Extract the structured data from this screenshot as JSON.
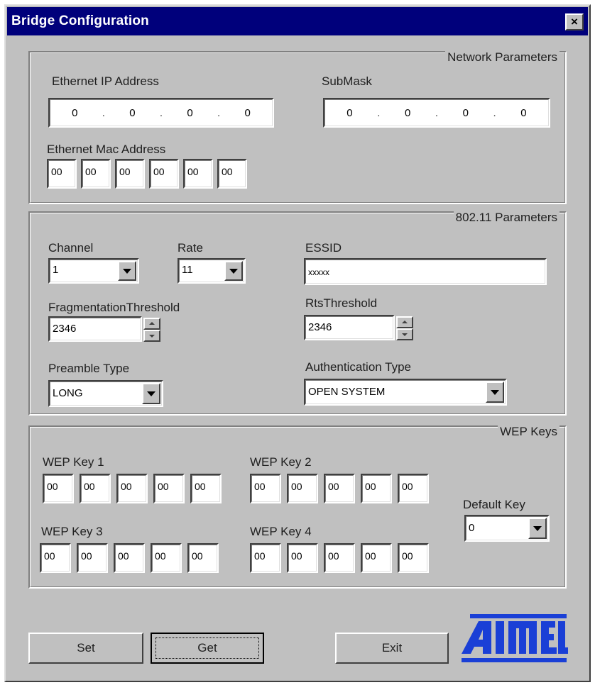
{
  "window": {
    "title": "Bridge Configuration",
    "close_label": "×"
  },
  "network": {
    "group_title": "Network Parameters",
    "ip_label": "Ethernet IP Address",
    "ip_octets": [
      "0",
      "0",
      "0",
      "0"
    ],
    "submask_label": "SubMask",
    "submask_octets": [
      "0",
      "0",
      "0",
      "0"
    ],
    "mac_label": "Ethernet Mac Address",
    "mac_bytes": [
      "00",
      "00",
      "00",
      "00",
      "00",
      "00"
    ]
  },
  "radio": {
    "group_title": "802.11 Parameters",
    "channel_label": "Channel",
    "channel_value": "1",
    "rate_label": "Rate",
    "rate_value": "11",
    "essid_label": "ESSID",
    "essid_value": "xxxxx",
    "frag_label": "FragmentationThreshold",
    "frag_value": "2346",
    "rts_label": "RtsThreshold",
    "rts_value": "2346",
    "preamble_label": "Preamble Type",
    "preamble_value": "LONG",
    "auth_label": "Authentication Type",
    "auth_value": "OPEN SYSTEM"
  },
  "wep": {
    "group_title": "WEP Keys",
    "keys": [
      {
        "label": "WEP Key 1",
        "bytes": [
          "00",
          "00",
          "00",
          "00",
          "00"
        ]
      },
      {
        "label": "WEP Key 2",
        "bytes": [
          "00",
          "00",
          "00",
          "00",
          "00"
        ]
      },
      {
        "label": "WEP Key 3",
        "bytes": [
          "00",
          "00",
          "00",
          "00",
          "00"
        ]
      },
      {
        "label": "WEP Key 4",
        "bytes": [
          "00",
          "00",
          "00",
          "00",
          "00"
        ]
      }
    ],
    "default_key_label": "Default Key",
    "default_key_value": "0"
  },
  "buttons": {
    "set": "Set",
    "get": "Get",
    "exit": "Exit"
  },
  "logo": {
    "text": "ATMEL",
    "color": "#1a3fd6"
  }
}
